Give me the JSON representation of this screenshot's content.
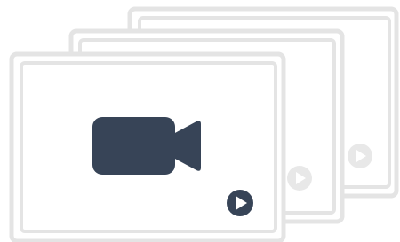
{
  "illustration": {
    "cards": [
      {
        "id": "back",
        "play_icon": "play-circle-icon",
        "icon_tone": "muted"
      },
      {
        "id": "middle",
        "play_icon": "play-circle-icon",
        "icon_tone": "muted"
      },
      {
        "id": "front",
        "main_icon": "video-camera-icon",
        "play_icon": "play-circle-icon",
        "icon_tone": "active"
      }
    ]
  },
  "colors": {
    "background": "#ffffff",
    "card_fill": "#ffffff",
    "card_border": "#e4e4e4",
    "card_inner_border": "#e4e4e4",
    "icon_dark": "#374457",
    "icon_muted": "#e8e8e8"
  }
}
